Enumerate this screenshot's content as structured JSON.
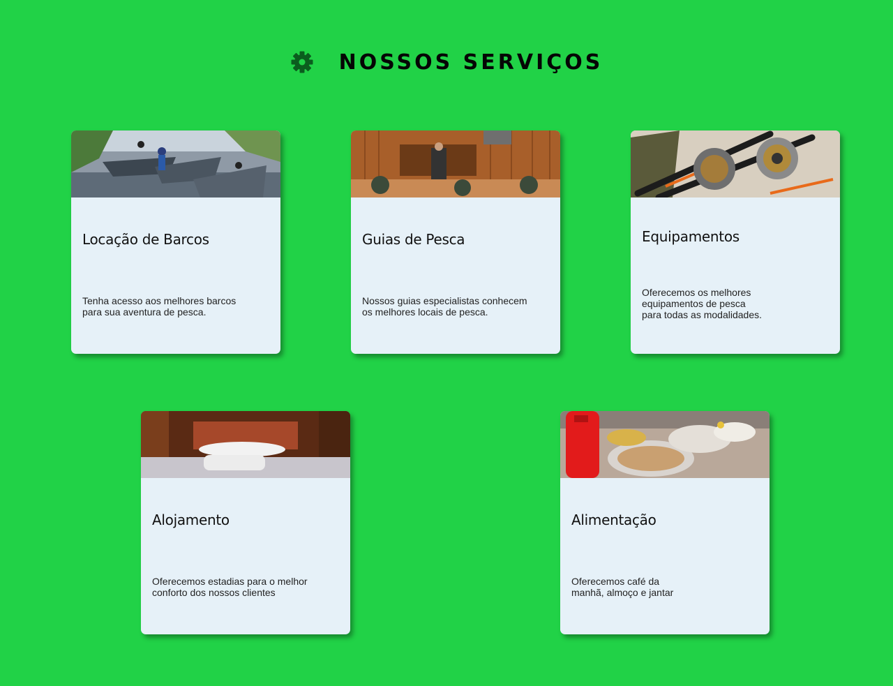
{
  "header": {
    "title": "NOSSOS SERVIÇOS",
    "icon": "gear-icon"
  },
  "colors": {
    "background": "#21d247",
    "card": "#e6f1f8",
    "icon": "#0b5d1e"
  },
  "services": [
    {
      "title": "Locação de Barcos",
      "description": "Tenha acesso aos melhores barcos\npara sua aventura de pesca."
    },
    {
      "title": "Guias de Pesca",
      "description": "Nossos guias especialistas conhecem\nos melhores locais de pesca."
    },
    {
      "title": "Equipamentos",
      "description": "Oferecemos os melhores\nequipamentos de pesca\npara todas as modalidades."
    },
    {
      "title": "Alojamento",
      "description": "Oferecemos estadias para o melhor\nconforto dos nossos clientes"
    },
    {
      "title": "Alimentação",
      "description": "Oferecemos café da\nmanhã, almoço e jantar"
    }
  ]
}
